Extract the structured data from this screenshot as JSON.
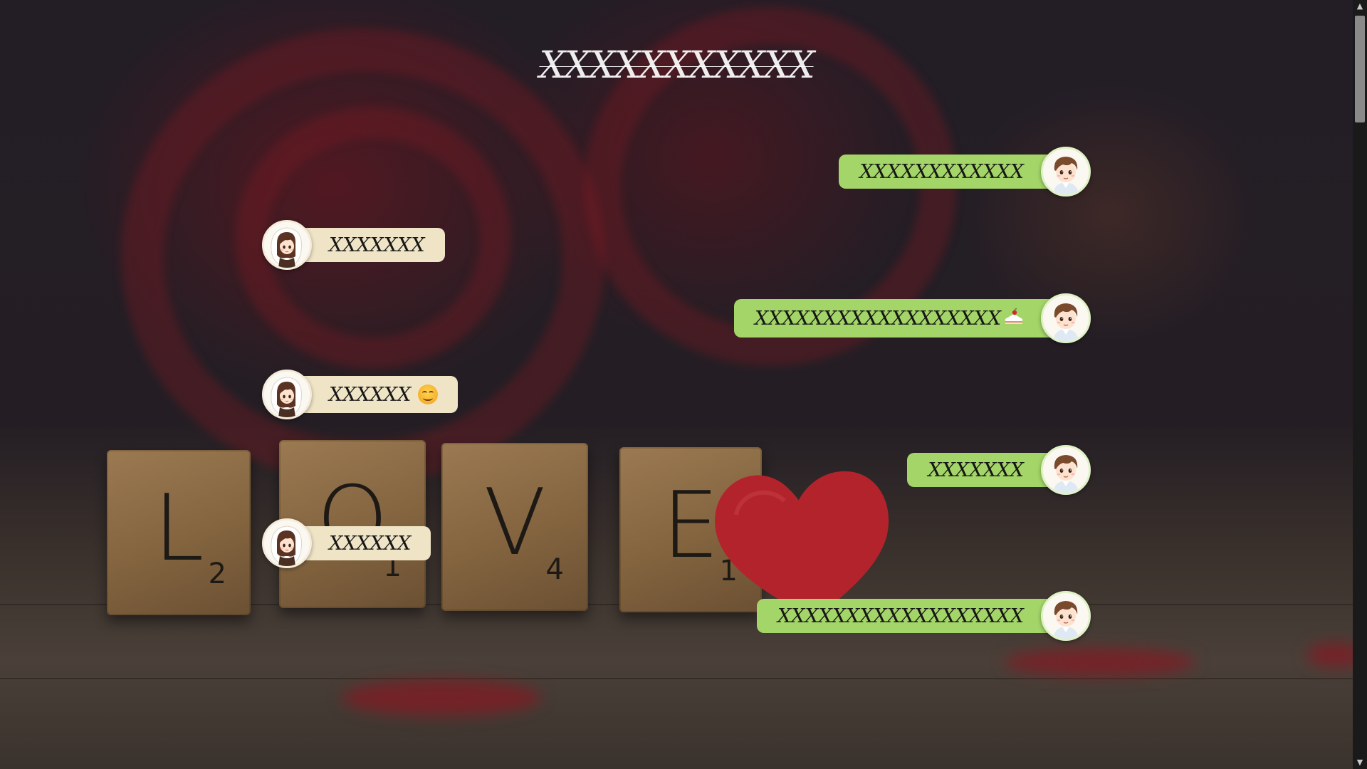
{
  "header": {
    "title": "XXXXXXXXXXX"
  },
  "background": {
    "tiles": [
      {
        "letter": "L",
        "score": "2"
      },
      {
        "letter": "O",
        "score": "1"
      },
      {
        "letter": "V",
        "score": "4"
      },
      {
        "letter": "E",
        "score": "1"
      }
    ]
  },
  "messages": [
    {
      "side": "sent",
      "text": "XXXXXXXXXXXX",
      "emoji": ""
    },
    {
      "side": "received",
      "text": "XXXXXXX",
      "emoji": ""
    },
    {
      "side": "sent",
      "text": "XXXXXXXXXXXXXXXXXX",
      "emoji": "cake"
    },
    {
      "side": "received",
      "text": "XXXXXX",
      "emoji": "smile"
    },
    {
      "side": "sent",
      "text": "XXXXXXX",
      "emoji": ""
    },
    {
      "side": "received",
      "text": "XXXXXX",
      "emoji": ""
    },
    {
      "side": "sent",
      "text": "XXXXXXXXXXXXXXXXXX",
      "emoji": ""
    }
  ],
  "colors": {
    "sent_bubble": "#a3d568",
    "received_bubble": "#efe4c6",
    "title": "#ffffff"
  },
  "icons": {
    "sent_avatar": "boy-avatar-icon",
    "received_avatar": "girl-avatar-icon",
    "scroll_up": "scroll-up-arrow-icon",
    "scroll_down": "scroll-down-arrow-icon"
  }
}
